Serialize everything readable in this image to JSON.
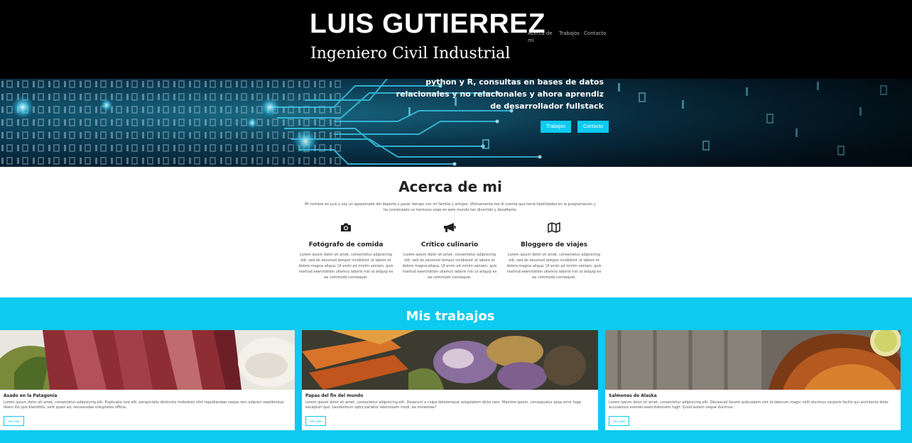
{
  "header": {
    "name": "LUIS GUTIERREZ",
    "subtitle": "Ingeniero Civil Industrial",
    "nav": [
      "Acerca de mi",
      "Trabajos",
      "Contacto"
    ]
  },
  "hero": {
    "text_lines": [
      "python y R, consultas en bases de datos",
      "relacionales y no relacionales y ahora aprendiz",
      "de desarrollador fullstack"
    ],
    "buttons": [
      "Trabajos",
      "Contacto"
    ]
  },
  "about": {
    "title": "Acerca de mi",
    "text": "Mi nombre es Luis y soy un apasionado del deporte y pasar tiempo con mi familia y amigos. Ultimamente me di cuenta que tenia habilidades en la programacion y he comenzado un hermoso viaje en este mundo tan divertido y desafiante.",
    "features": [
      {
        "icon": "camera-icon",
        "title": "Fotógrafo de comida",
        "text": "Lorem ipsum dolor sit amet, consectetur adipisicing elit, sed do eiusmod tempor incididunt ut labore et dolore magna aliqua. Ut enim ad minim veniam, quis nostrud exercitation ullamco laboris nisi ut aliquip ex ea commodo consequat."
      },
      {
        "icon": "megaphone-icon",
        "title": "Crítico culinario",
        "text": "Lorem ipsum dolor sit amet, consectetur adipisicing elit, sed do eiusmod tempor incididunt ut labore et dolore magna aliqua. Ut enim ad minim veniam, quis nostrud exercitation ullamco laboris nisi ut aliquip ex ea commodo consequat."
      },
      {
        "icon": "map-icon",
        "title": "Bloggero de viajes",
        "text": "Lorem ipsum dolor sit amet, consectetur adipisicing elit, sed do eiusmod tempor incididunt ut labore et dolore magna aliqua. Ut enim ad minim veniam, quis nostrud exercitation ullamco laboris nisi ut aliquip ex ea commodo consequat."
      }
    ]
  },
  "works": {
    "title": "Mis trabajos",
    "cards": [
      {
        "title": "Asado en la Patagonia",
        "text": "Lorem ipsum dolor sit amet, consectetur adipisicing elit. Explicabo iure elit, perspiciatis distinctio molestias nihil repudiandae neque rem adipisci repellendus libero illo quo blanditiis, velit quasi ad, recusandae voluptates officia.",
        "button": "Ver más"
      },
      {
        "title": "Papas del fin del mundo",
        "text": "Lorem ipsum dolor sit amet, consectetur adipisicing elit. Deserunt a culpa doloremque voluptatem dicta nam. Maxime ipsum, consequatur quos error fuga excepturi quo. Laudantium optio pariatur laboriosam modi, ea molestiae?",
        "button": "Ver más"
      },
      {
        "title": "Salmones de Alaska",
        "text": "Lorem ipsum dolor sit amet, consectetur adipisicing elit. Obcaecati facere quibusdam sint id laborum magni velit ducimus corporis facilis qui architecto dolor accusamus eveniet exercitationem fugit. Quod autem neque ducimus.",
        "button": "Ver más"
      }
    ]
  },
  "colors": {
    "accent": "#0dcaf0",
    "header_bg": "#000000"
  }
}
